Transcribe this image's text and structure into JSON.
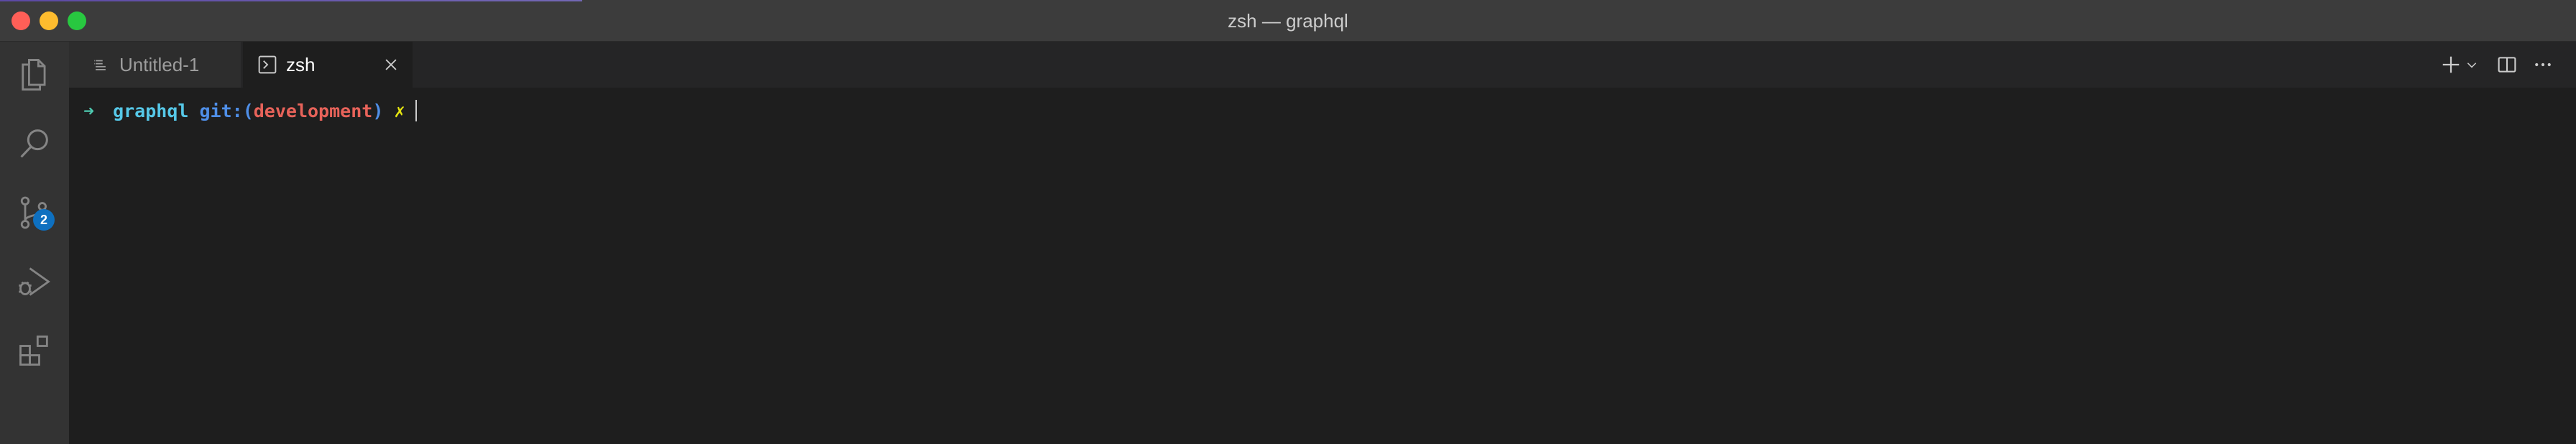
{
  "window": {
    "title": "zsh — graphql"
  },
  "activity_bar": {
    "items": [
      {
        "name": "explorer",
        "icon": "files-icon"
      },
      {
        "name": "search",
        "icon": "search-icon"
      },
      {
        "name": "source-control",
        "icon": "source-control-icon",
        "badge": "2"
      },
      {
        "name": "run-debug",
        "icon": "run-debug-icon"
      },
      {
        "name": "extensions",
        "icon": "extensions-icon"
      }
    ]
  },
  "tabs": [
    {
      "label": "Untitled-1",
      "icon": "text-file-icon",
      "active": false
    },
    {
      "label": "zsh",
      "icon": "terminal-icon",
      "active": true,
      "close_icon": "close-icon"
    }
  ],
  "toolbar": {
    "new_icon": "plus-icon",
    "dropdown_icon": "chevron-down-icon",
    "split_icon": "split-editor-icon",
    "more_icon": "ellipsis-icon"
  },
  "terminal": {
    "arrow": "➜",
    "directory": "graphql",
    "git_prefix": "git:(",
    "branch": "development",
    "git_suffix": ")",
    "dirty_marker": "✗"
  },
  "colors": {
    "background": "#1e1e1e",
    "titlebar": "#3c3c3c",
    "activity_bar": "#333333",
    "badge": "#0e70c0",
    "prompt_arrow": "#4ec9b0",
    "prompt_dir": "#56c8e8",
    "prompt_git": "#4f8fe8",
    "prompt_branch": "#e8635a",
    "prompt_dirty": "#e5e510"
  }
}
